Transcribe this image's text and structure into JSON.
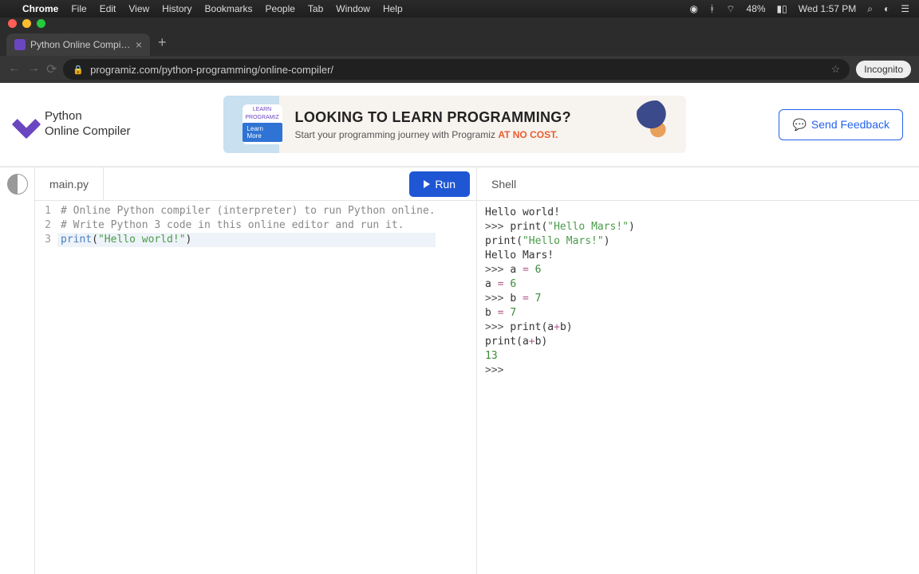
{
  "menubar": {
    "app": "Chrome",
    "items": [
      "File",
      "Edit",
      "View",
      "History",
      "Bookmarks",
      "People",
      "Tab",
      "Window",
      "Help"
    ],
    "battery": "48%",
    "clock": "Wed 1:57 PM"
  },
  "browser": {
    "tab_title": "Python Online Compiler (Inter",
    "url": "programiz.com/python-programming/online-compiler/",
    "incognito": "Incognito"
  },
  "header": {
    "logo_line1": "Python",
    "logo_line2": "Online Compiler",
    "banner_title": "LOOKING TO LEARN PROGRAMMING?",
    "banner_sub_pre": "Start your programming journey with Programiz ",
    "banner_sub_em": "AT NO COST.",
    "banner_learn": "LEARN",
    "banner_learn2": "PROGRAMIZ",
    "banner_learn_btn": "Learn More",
    "feedback": "Send Feedback"
  },
  "editor": {
    "tab": "main.py",
    "run": "Run",
    "line_numbers": [
      "1",
      "2",
      "3"
    ],
    "line1": "# Online Python compiler (interpreter) to run Python online.",
    "line2": "# Write Python 3 code in this online editor and run it.",
    "line3_fn": "print",
    "line3_open": "(",
    "line3_str": "\"Hello world!\"",
    "line3_close": ")"
  },
  "shell": {
    "tab": "Shell",
    "lines": [
      {
        "t": "plain",
        "text": "Hello world!"
      },
      {
        "t": "in",
        "prompt": ">>> ",
        "parts": [
          {
            "k": "fn",
            "v": "print"
          },
          {
            "k": "p",
            "v": "("
          },
          {
            "k": "str",
            "v": "\"Hello Mars!\""
          },
          {
            "k": "p",
            "v": ")"
          }
        ]
      },
      {
        "t": "echo",
        "parts": [
          {
            "k": "fn",
            "v": "print"
          },
          {
            "k": "p",
            "v": "("
          },
          {
            "k": "str",
            "v": "\"Hello Mars!\""
          },
          {
            "k": "p",
            "v": ")"
          }
        ]
      },
      {
        "t": "plain",
        "text": "Hello Mars!"
      },
      {
        "t": "in",
        "prompt": ">>> ",
        "parts": [
          {
            "k": "id",
            "v": "a "
          },
          {
            "k": "op",
            "v": "="
          },
          {
            "k": "id",
            "v": " "
          },
          {
            "k": "num",
            "v": "6"
          }
        ]
      },
      {
        "t": "echo",
        "parts": [
          {
            "k": "id",
            "v": "a "
          },
          {
            "k": "op",
            "v": "="
          },
          {
            "k": "id",
            "v": " "
          },
          {
            "k": "num",
            "v": "6"
          }
        ]
      },
      {
        "t": "in",
        "prompt": ">>> ",
        "parts": [
          {
            "k": "id",
            "v": "b "
          },
          {
            "k": "op",
            "v": "="
          },
          {
            "k": "id",
            "v": " "
          },
          {
            "k": "num",
            "v": "7"
          }
        ]
      },
      {
        "t": "echo",
        "parts": [
          {
            "k": "id",
            "v": "b "
          },
          {
            "k": "op",
            "v": "="
          },
          {
            "k": "id",
            "v": " "
          },
          {
            "k": "num",
            "v": "7"
          }
        ]
      },
      {
        "t": "in",
        "prompt": ">>> ",
        "parts": [
          {
            "k": "fn",
            "v": "print"
          },
          {
            "k": "p",
            "v": "("
          },
          {
            "k": "id",
            "v": "a"
          },
          {
            "k": "op",
            "v": "+"
          },
          {
            "k": "id",
            "v": "b"
          },
          {
            "k": "p",
            "v": ")"
          }
        ]
      },
      {
        "t": "echo",
        "parts": [
          {
            "k": "fn",
            "v": "print"
          },
          {
            "k": "p",
            "v": "("
          },
          {
            "k": "id",
            "v": "a"
          },
          {
            "k": "op",
            "v": "+"
          },
          {
            "k": "id",
            "v": "b"
          },
          {
            "k": "p",
            "v": ")"
          }
        ]
      },
      {
        "t": "num",
        "text": "13"
      },
      {
        "t": "prompt",
        "text": ">>> "
      }
    ]
  }
}
